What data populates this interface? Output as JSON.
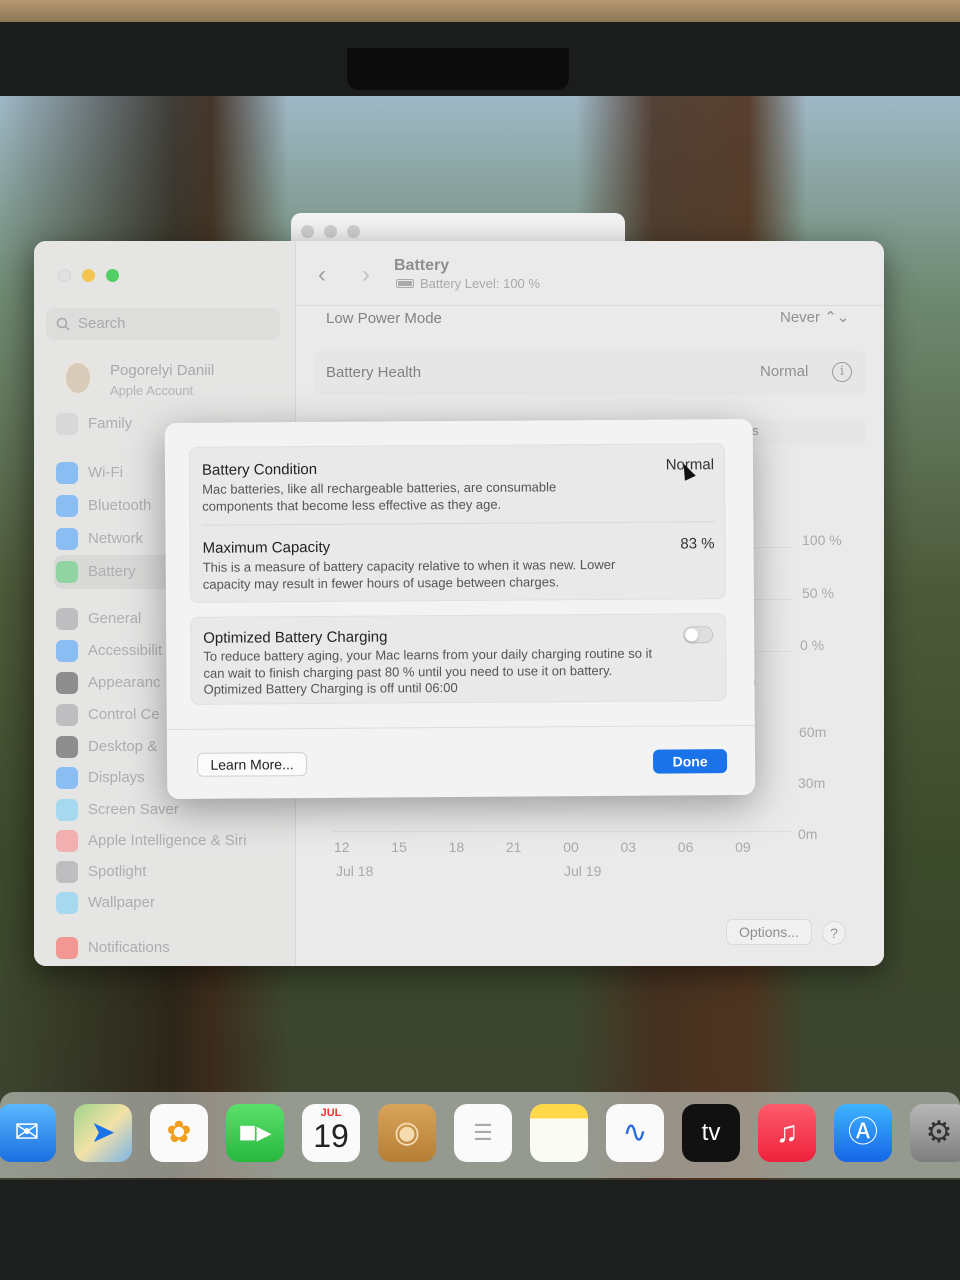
{
  "sidebar": {
    "search_placeholder": "Search",
    "account_name": "Pogorelyi Daniil",
    "account_sub": "Apple Account",
    "items": [
      {
        "label": "Family",
        "icon": "family-icon",
        "color": "#c9c9c9"
      },
      {
        "label": "Wi-Fi",
        "icon": "wifi-icon",
        "color": "#1a8cff"
      },
      {
        "label": "Bluetooth",
        "icon": "bluetooth-icon",
        "color": "#1a8cff"
      },
      {
        "label": "Network",
        "icon": "network-icon",
        "color": "#1a8cff"
      },
      {
        "label": "Battery",
        "icon": "battery-icon",
        "color": "#34c759"
      },
      {
        "label": "General",
        "icon": "general-icon",
        "color": "#8e8e93"
      },
      {
        "label": "Accessibilit",
        "icon": "accessibility-icon",
        "color": "#1a8cff"
      },
      {
        "label": "Appearanc",
        "icon": "appearance-icon",
        "color": "#222222"
      },
      {
        "label": "Control Ce",
        "icon": "control-center-icon",
        "color": "#8e8e93"
      },
      {
        "label": "Desktop &",
        "icon": "desktop-dock-icon",
        "color": "#222222"
      },
      {
        "label": "Displays",
        "icon": "displays-icon",
        "color": "#1a8cff"
      },
      {
        "label": "Screen Saver",
        "icon": "screen-saver-icon",
        "color": "#5ac8fa"
      },
      {
        "label": "Apple Intelligence & Siri",
        "icon": "siri-icon",
        "color": "#ff6b6b"
      },
      {
        "label": "Spotlight",
        "icon": "spotlight-icon",
        "color": "#8e8e93"
      },
      {
        "label": "Wallpaper",
        "icon": "wallpaper-icon",
        "color": "#5ac8fa"
      },
      {
        "label": "Notifications",
        "icon": "notifications-icon",
        "color": "#ff3b30"
      }
    ]
  },
  "content": {
    "title": "Battery",
    "subtitle": "Battery Level: 100 %",
    "low_power_label": "Low Power Mode",
    "low_power_value": "Never",
    "health_label": "Battery Health",
    "health_value": "Normal",
    "partial_tab": "s",
    "y_percent_labels": [
      "100 %",
      "50 %",
      "0 %"
    ],
    "y_time_labels": [
      "60m",
      "30m",
      "0m"
    ],
    "partial_label": "9",
    "x_hours": [
      "12",
      "15",
      "18",
      "21",
      "00",
      "03",
      "06",
      "09"
    ],
    "x_dates": [
      "Jul 18",
      "Jul 19"
    ],
    "options_label": "Options...",
    "help_label": "?"
  },
  "sheet": {
    "condition_title": "Battery Condition",
    "condition_value": "Normal",
    "condition_desc": "Mac batteries, like all rechargeable batteries, are consumable components that become less effective as they age.",
    "capacity_title": "Maximum Capacity",
    "capacity_value": "83 %",
    "capacity_desc": "This is a measure of battery capacity relative to when it was new. Lower capacity may result in fewer hours of usage between charges.",
    "optimized_title": "Optimized Battery Charging",
    "optimized_desc": "To reduce battery aging, your Mac learns from your daily charging routine so it can wait to finish charging past 80 % until you need to use it on battery. Optimized Battery Charging is off until 06:00",
    "optimized_enabled": false,
    "learn_more": "Learn More...",
    "done": "Done",
    "accent": "#1a73e8"
  },
  "dock": {
    "calendar_month": "JUL",
    "calendar_day": "19",
    "appletv_label": "tv",
    "apps": [
      "mail-icon",
      "maps-icon",
      "photos-icon",
      "facetime-icon",
      "calendar-icon",
      "contacts-icon",
      "reminders-icon",
      "notes-icon",
      "freeform-icon",
      "appletv-icon",
      "music-icon",
      "appstore-icon",
      "system-settings-icon"
    ]
  }
}
